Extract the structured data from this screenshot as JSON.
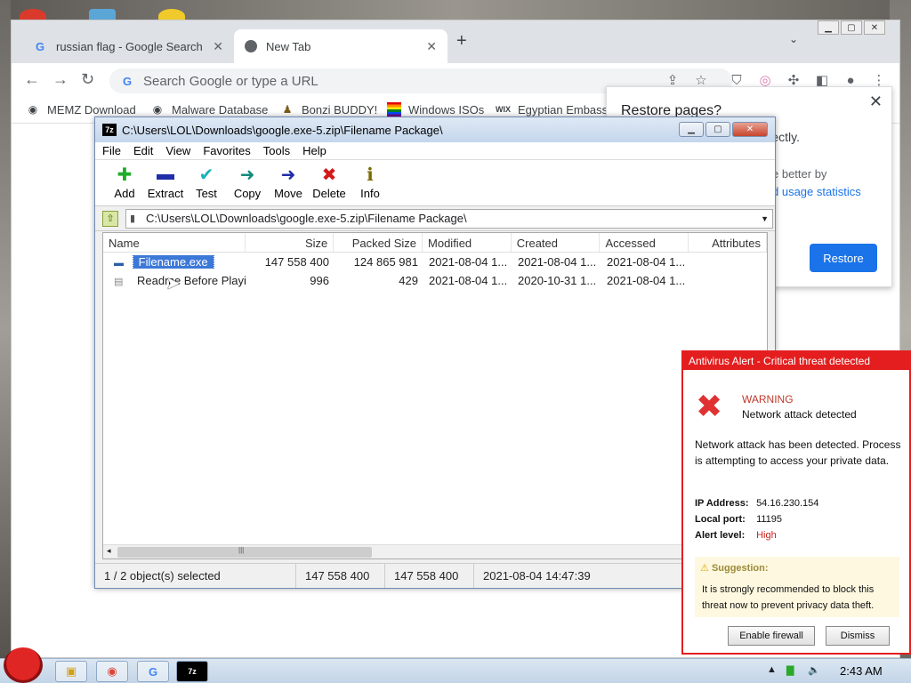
{
  "browser": {
    "tabs": [
      {
        "title": "russian flag - Google Search",
        "icon": "google-icon"
      },
      {
        "title": "New Tab",
        "icon": "chrome-icon"
      }
    ],
    "close_glyph": "✕",
    "new_tab_glyph": "+",
    "omnibox_placeholder": "Search Google or type a URL",
    "bookmarks": [
      {
        "label": "MEMZ Download",
        "icon": "globe-icon"
      },
      {
        "label": "Malware Database",
        "icon": "globe-icon"
      },
      {
        "label": "Bonzi BUDDY!",
        "icon": "bonzi-icon"
      },
      {
        "label": "Windows ISOs",
        "icon": "rainbow-flag-icon"
      },
      {
        "label": "Egyptian Embassy",
        "icon": "wix-icon"
      }
    ],
    "wix_text": "WIX"
  },
  "restore_dialog": {
    "title": "Restore pages?",
    "line1": "rrectly.",
    "line2": "e better by",
    "line3": "d usage statistics",
    "button": "Restore"
  },
  "zip": {
    "title": "C:\\Users\\LOL\\Downloads\\google.exe-5.zip\\Filename Package\\",
    "app_icon_text": "7z",
    "menu": [
      "File",
      "Edit",
      "View",
      "Favorites",
      "Tools",
      "Help"
    ],
    "tools": [
      {
        "label": "Add",
        "icon": "plus-icon",
        "glyph": "✚",
        "color": "#1fae2a"
      },
      {
        "label": "Extract",
        "icon": "minus-icon",
        "glyph": "▬",
        "color": "#1f2ea8"
      },
      {
        "label": "Test",
        "icon": "check-icon",
        "glyph": "✔",
        "color": "#17b2b8"
      },
      {
        "label": "Copy",
        "icon": "copy-arrow-icon",
        "glyph": "➜",
        "color": "#138a7b"
      },
      {
        "label": "Move",
        "icon": "move-arrow-icon",
        "glyph": "➜",
        "color": "#1f2ea8"
      },
      {
        "label": "Delete",
        "icon": "delete-x-icon",
        "glyph": "✖",
        "color": "#d11a1a"
      },
      {
        "label": "Info",
        "icon": "info-icon",
        "glyph": "ℹ",
        "color": "#7a6a00"
      }
    ],
    "address": "C:\\Users\\LOL\\Downloads\\google.exe-5.zip\\Filename Package\\",
    "columns": [
      "Name",
      "Size",
      "Packed Size",
      "Modified",
      "Created",
      "Accessed",
      "Attributes"
    ],
    "rows": [
      {
        "name": "Filename.exe",
        "size": "147 558 400",
        "packed": "124 865 981",
        "modified": "2021-08-04 1...",
        "created": "2021-08-04 1...",
        "accessed": "2021-08-04 1...",
        "selected": true
      },
      {
        "name": "Readme Before Playi...",
        "size": "996",
        "packed": "429",
        "modified": "2021-08-04 1...",
        "created": "2020-10-31 1...",
        "accessed": "2021-08-04 1...",
        "selected": false
      }
    ],
    "scroll_grip": "|||",
    "status": [
      "1 / 2 object(s) selected",
      "147 558 400",
      "147 558 400",
      "2021-08-04 14:47:39"
    ]
  },
  "antivirus": {
    "header": "Antivirus Alert - Critical threat detected",
    "warning_title": "WARNING",
    "warning_sub": "Network attack detected",
    "message": "Network attack has been detected. Process is attempting to access your private data.",
    "ip_label": "IP Address:",
    "ip_value": "54.16.230.154",
    "port_label": "Local port:",
    "port_value": "11195",
    "level_label": "Alert level:",
    "level_value": "High",
    "suggestion_title": "Suggestion:",
    "suggestion_body": "It is strongly recommended to block this threat now to prevent privacy data theft.",
    "btn_enable": "Enable firewall",
    "btn_dismiss": "Dismiss"
  },
  "taskbar": {
    "time": "2:43 AM",
    "zip_label": "7z"
  },
  "colors": {
    "accent_blue": "#1a73e8",
    "alert_red": "#e41e1e",
    "selection": "#3c78d8"
  }
}
